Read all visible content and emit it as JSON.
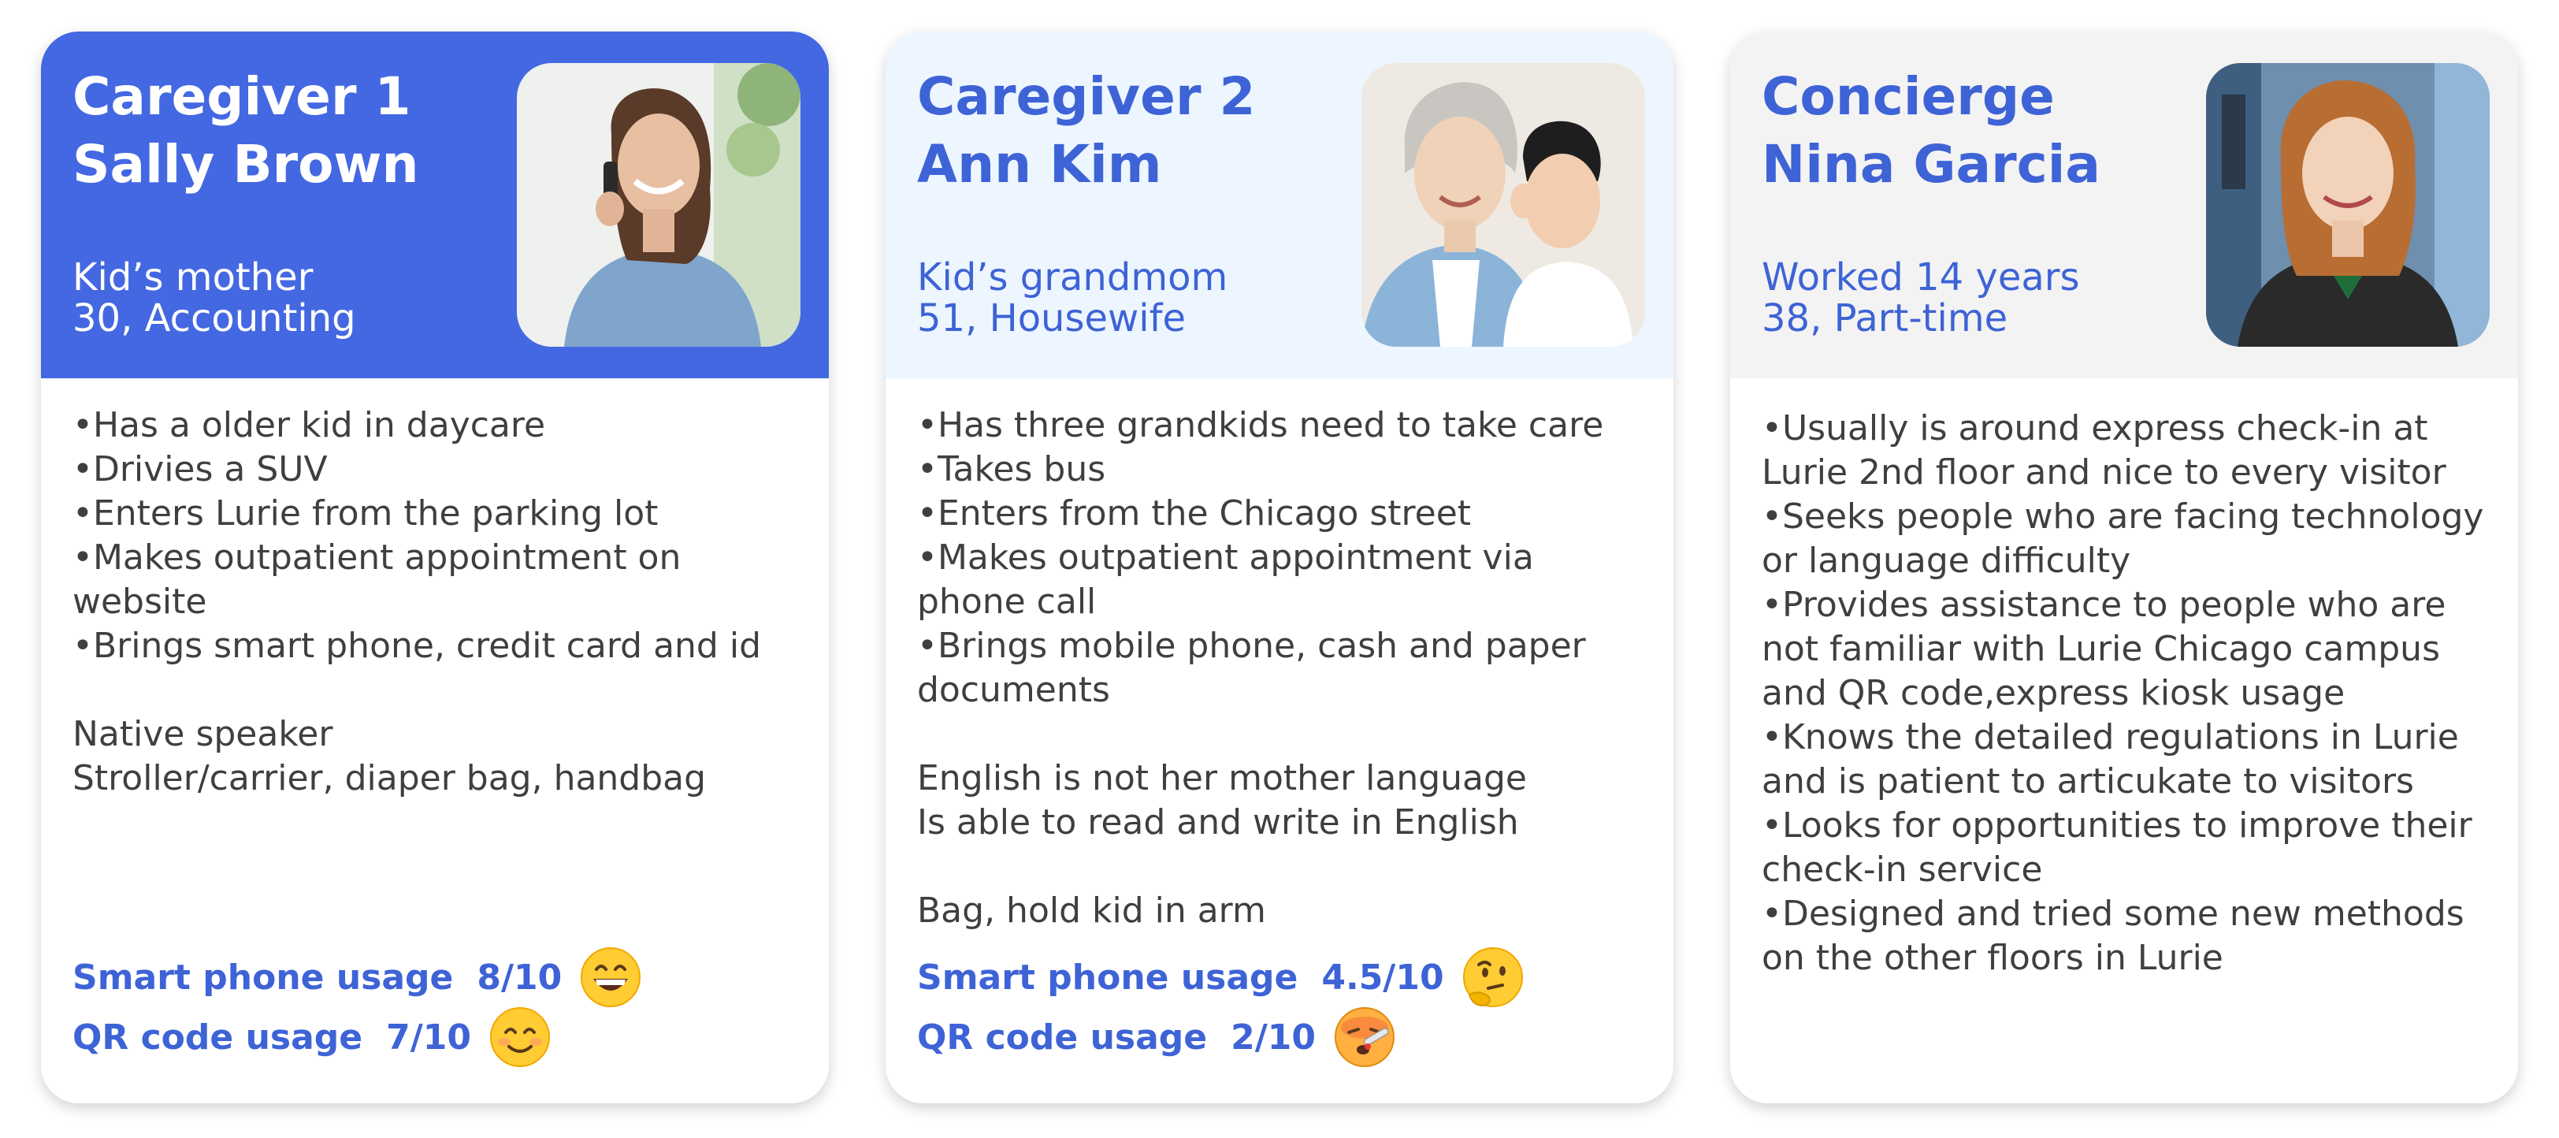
{
  "cards": [
    {
      "title_lines": [
        "Caregiver 1",
        "Sally Brown"
      ],
      "subtitle_lines": [
        "Kid’s mother",
        "30, Accounting"
      ],
      "photo": "woman-on-phone-photo",
      "body_lines": [
        "•Has a older kid in daycare",
        "•Drivies a SUV",
        "•Enters Lurie from the parking lot",
        "•Makes outpatient appointment on",
        "website",
        "•Brings smart phone, credit card and id",
        "",
        "Native speaker",
        "Stroller/carrier, diaper bag, handbag"
      ],
      "metrics": [
        {
          "label": "Smart phone usage",
          "value": "8/10",
          "icon": "grinning-face-icon"
        },
        {
          "label": "QR code usage",
          "value": "7/10",
          "icon": "smiling-face-icon"
        }
      ]
    },
    {
      "title_lines": [
        "Caregiver 2",
        "Ann Kim"
      ],
      "subtitle_lines": [
        "Kid’s grandmom",
        "51, Housewife"
      ],
      "photo": "grandmother-and-child-photo",
      "body_lines": [
        "•Has three grandkids need to take care",
        "•Takes bus",
        "•Enters from the Chicago street",
        "•Makes outpatient appointment via",
        "phone call",
        "•Brings mobile phone, cash and paper",
        "documents",
        "",
        "English is not her mother language",
        "Is able to read and write in English",
        "",
        "Bag, hold kid in arm"
      ],
      "metrics": [
        {
          "label": "Smart phone usage",
          "value": "4.5/10",
          "icon": "thinking-face-icon"
        },
        {
          "label": "QR code usage",
          "value": "2/10",
          "icon": "face-with-thermometer-icon"
        }
      ]
    },
    {
      "title_lines": [
        "Concierge",
        "Nina Garcia"
      ],
      "subtitle_lines": [
        "Worked 14 years",
        "38, Part-time"
      ],
      "photo": "concierge-woman-photo",
      "body_lines": [
        "•Usually is around express check-in at",
        "Lurie 2nd floor and nice to every visitor",
        "•Seeks people who are facing technology",
        "or language difficulty",
        "•Provides assistance to people who are",
        "not familiar with Lurie Chicago campus",
        "and QR code,express kiosk usage",
        "•Knows the detailed regulations in Lurie",
        "and is patient to articukate to visitors",
        "•Looks for opportunities to improve their",
        "check-in service",
        "•Designed and tried some new methods",
        "on the other floors in Lurie"
      ],
      "metrics": []
    }
  ],
  "colors": {
    "accent": "#4468e2",
    "accent_text": "#3e63d6",
    "header_light_blue": "#edf6fe",
    "header_gray": "#f3f3f3",
    "body_text": "#3f3f3f"
  }
}
